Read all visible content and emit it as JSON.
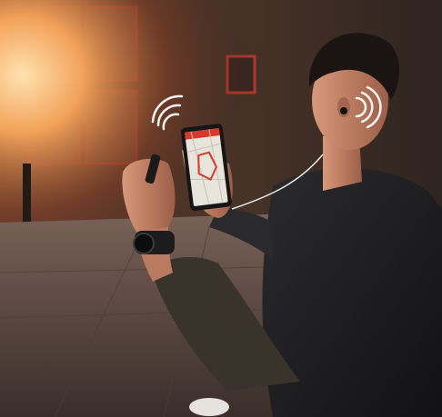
{
  "image": {
    "palette": {
      "sky_glow": "#f7b36a",
      "brick_dark": "#3b2a22",
      "brick_mid": "#5a3d2e",
      "window_red": "#c2382c",
      "pavement": "#6d5a50",
      "pavement_dark": "#3d302b",
      "skin": "#c9876a",
      "skin_shadow": "#8c5442",
      "hair": "#1b1413",
      "shirt": "#1d1d1f",
      "sleeve": "#3a332c",
      "phone_frame": "#151516",
      "map_bg": "#e7e4dc",
      "route": "#d9392b",
      "signal_white": "#f5f5f5"
    },
    "icons": [
      "wireless-signal-icon",
      "wireless-signal-icon"
    ]
  }
}
